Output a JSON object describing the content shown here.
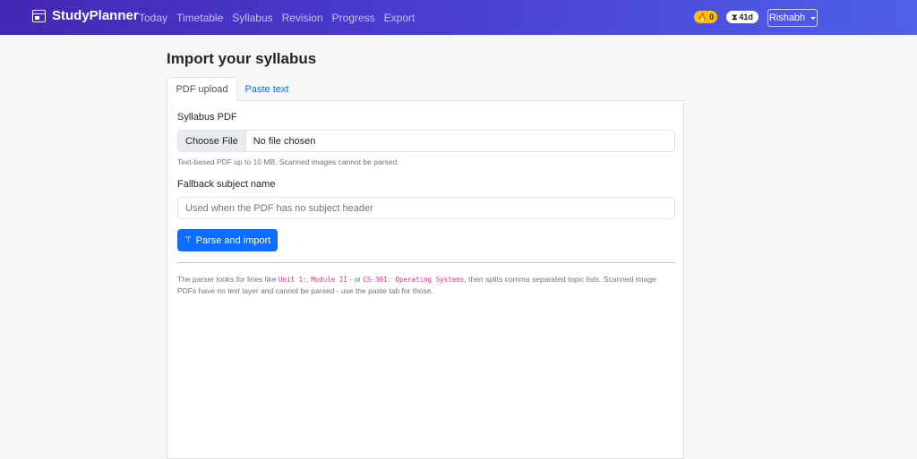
{
  "navbar": {
    "brand": "StudyPlanner",
    "links": [
      "Today",
      "Timetable",
      "Syllabus",
      "Revision",
      "Progress",
      "Export"
    ],
    "streak_badge": "0",
    "days_badge": "41d",
    "user": "Rishabh"
  },
  "page": {
    "title": "Import your syllabus",
    "tabs": [
      "PDF upload",
      "Paste text"
    ]
  },
  "form": {
    "pdf_label": "Syllabus PDF",
    "file_button": "Choose File",
    "file_status": "No file chosen",
    "pdf_help": "Text-based PDF up to 10 MB. Scanned images cannot be parsed.",
    "subject_label": "Fallback subject name",
    "subject_placeholder": "Used when the PDF has no subject header",
    "submit_label": "Parse and import"
  },
  "note": {
    "t1": "The parser looks for lines like ",
    "c1": "Unit 1:",
    "sep": ", ",
    "c2": "Module II",
    "t2": " - or ",
    "c3": "CS-301: Operating Systems",
    "t3": ", then splits comma separated topic lists. Scanned image PDFs have no text layer and cannot be parsed - use the paste tab for those."
  },
  "colors": {
    "nav_start": "#4427b5",
    "nav_end": "#4f60ea",
    "primary": "#0d6efd",
    "badge_warning": "#ffc107",
    "code": "#d63384"
  },
  "icons": {
    "brand": "calendar-icon",
    "streak": "fire-icon",
    "days": "hourglass-icon",
    "submit": "magic-wand-icon"
  }
}
